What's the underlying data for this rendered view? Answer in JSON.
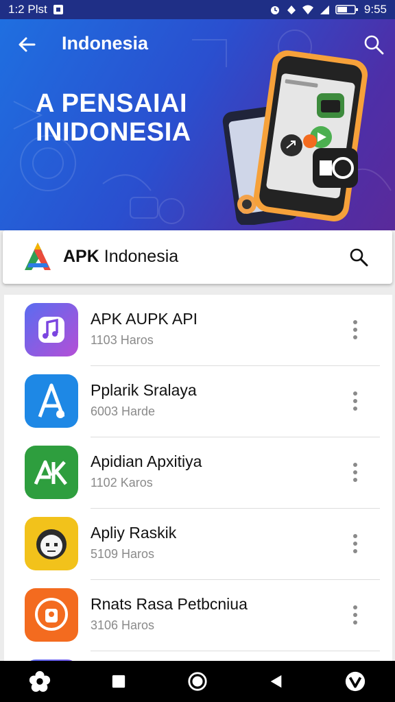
{
  "status_bar": {
    "carrier": "1:2 Plst",
    "time": "9:55",
    "icons": [
      "sim-card-icon",
      "alarm-icon",
      "wifi-icon",
      "signal-icon",
      "battery-icon"
    ]
  },
  "header": {
    "title": "Indonesia",
    "hero_line1": "A PENSAIAI",
    "hero_line2": "INIDONESIA"
  },
  "search_card": {
    "brand_bold": "APK",
    "brand_rest": " Indonesia"
  },
  "apps": [
    {
      "name": "APK AUPK API",
      "meta": "1103 Haros",
      "icon": "music-note-icon",
      "color": "#8a3ee0"
    },
    {
      "name": "Pplarik Sralaya",
      "meta": "6003 Harde",
      "icon": "letter-a-icon",
      "color": "#1e88e5"
    },
    {
      "name": "Apidian Apxitiya",
      "meta": "1102 Karos",
      "icon": "ak-logo-icon",
      "color": "#2e9e3e"
    },
    {
      "name": "Apliy Raskik",
      "meta": "5109 Haros",
      "icon": "robot-face-icon",
      "color": "#f2c21b"
    },
    {
      "name": "Rnats Rasa Petbcniua",
      "meta": "3106 Haros",
      "icon": "pin-icon",
      "color": "#f36b1f"
    }
  ],
  "nav": [
    "flower-icon",
    "square-icon",
    "home-circle-icon",
    "back-triangle-icon",
    "v-logo-icon"
  ]
}
